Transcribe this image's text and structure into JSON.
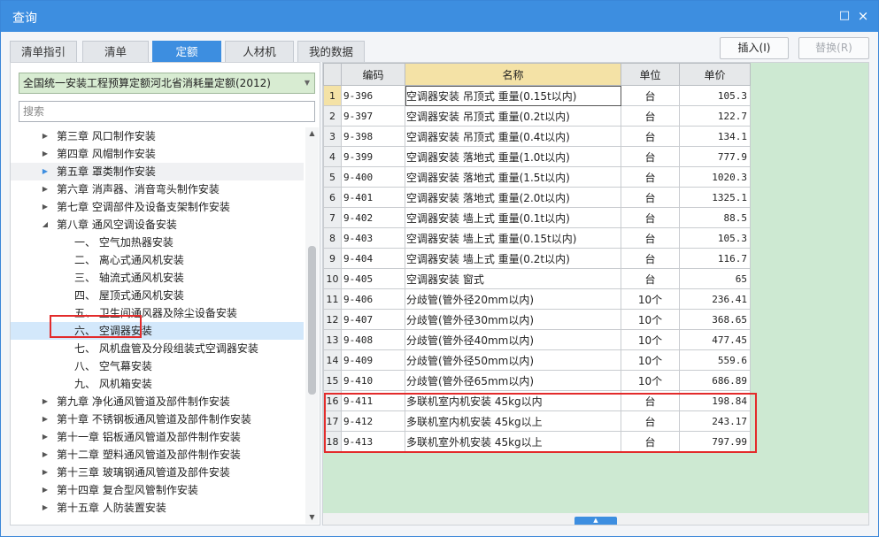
{
  "window": {
    "title": "查询",
    "maximize_icon": "maximize-icon",
    "close_icon": "close-icon",
    "close_glyph": "×",
    "maximize_glyph": "□"
  },
  "tabs": [
    {
      "label": "清单指引",
      "active": false
    },
    {
      "label": "清单",
      "active": false
    },
    {
      "label": "定额",
      "active": true
    },
    {
      "label": "人材机",
      "active": false
    },
    {
      "label": "我的数据",
      "active": false
    }
  ],
  "toolbar": {
    "insert_label": "插入(I)",
    "replace_label": "替换(R)"
  },
  "left": {
    "quota_library": "全国统一安装工程预算定额河北省消耗量定额(2012)",
    "search_placeholder": "搜索",
    "tree": [
      {
        "label": "第三章 风口制作安装",
        "level": 0,
        "expander": "collapsed"
      },
      {
        "label": "第四章 风帽制作安装",
        "level": 0,
        "expander": "collapsed"
      },
      {
        "label": "第五章 罩类制作安装",
        "level": 0,
        "expander": "collapsed-active",
        "highlight": true
      },
      {
        "label": "第六章 消声器、消音弯头制作安装",
        "level": 0,
        "expander": "collapsed"
      },
      {
        "label": "第七章 空调部件及设备支架制作安装",
        "level": 0,
        "expander": "collapsed"
      },
      {
        "label": "第八章 通风空调设备安装",
        "level": 0,
        "expander": "expanded"
      },
      {
        "label": "一、 空气加热器安装",
        "level": 1
      },
      {
        "label": "二、 离心式通风机安装",
        "level": 1
      },
      {
        "label": "三、 轴流式通风机安装",
        "level": 1
      },
      {
        "label": "四、 屋顶式通风机安装",
        "level": 1
      },
      {
        "label": "五、 卫生间通风器及除尘设备安装",
        "level": 1
      },
      {
        "label": "六、 空调器安装",
        "level": 1,
        "selected": true
      },
      {
        "label": "七、 风机盘管及分段组装式空调器安装",
        "level": 1
      },
      {
        "label": "八、 空气幕安装",
        "level": 1
      },
      {
        "label": "九、 风机箱安装",
        "level": 1
      },
      {
        "label": "第九章 净化通风管道及部件制作安装",
        "level": 0,
        "expander": "collapsed"
      },
      {
        "label": "第十章 不锈钢板通风管道及部件制作安装",
        "level": 0,
        "expander": "collapsed"
      },
      {
        "label": "第十一章 铝板通风管道及部件制作安装",
        "level": 0,
        "expander": "collapsed"
      },
      {
        "label": "第十二章 塑料通风管道及部件制作安装",
        "level": 0,
        "expander": "collapsed"
      },
      {
        "label": "第十三章 玻璃钢通风管道及部件安装",
        "level": 0,
        "expander": "collapsed"
      },
      {
        "label": "第十四章 复合型风管制作安装",
        "level": 0,
        "expander": "collapsed"
      },
      {
        "label": "第十五章 人防装置安装",
        "level": 0,
        "expander": "collapsed"
      }
    ]
  },
  "grid": {
    "headers": [
      "",
      "编码",
      "名称",
      "单位",
      "单价"
    ],
    "rows": [
      {
        "no": "1",
        "code": "9-396",
        "name": "空调器安装 吊顶式 重量(0.15t以内)",
        "unit": "台",
        "price": "105.3"
      },
      {
        "no": "2",
        "code": "9-397",
        "name": "空调器安装 吊顶式 重量(0.2t以内)",
        "unit": "台",
        "price": "122.7"
      },
      {
        "no": "3",
        "code": "9-398",
        "name": "空调器安装 吊顶式 重量(0.4t以内)",
        "unit": "台",
        "price": "134.1"
      },
      {
        "no": "4",
        "code": "9-399",
        "name": "空调器安装 落地式 重量(1.0t以内)",
        "unit": "台",
        "price": "777.9"
      },
      {
        "no": "5",
        "code": "9-400",
        "name": "空调器安装 落地式 重量(1.5t以内)",
        "unit": "台",
        "price": "1020.3"
      },
      {
        "no": "6",
        "code": "9-401",
        "name": "空调器安装 落地式 重量(2.0t以内)",
        "unit": "台",
        "price": "1325.1"
      },
      {
        "no": "7",
        "code": "9-402",
        "name": "空调器安装 墙上式 重量(0.1t以内)",
        "unit": "台",
        "price": "88.5"
      },
      {
        "no": "8",
        "code": "9-403",
        "name": "空调器安装 墙上式 重量(0.15t以内)",
        "unit": "台",
        "price": "105.3"
      },
      {
        "no": "9",
        "code": "9-404",
        "name": "空调器安装 墙上式 重量(0.2t以内)",
        "unit": "台",
        "price": "116.7"
      },
      {
        "no": "10",
        "code": "9-405",
        "name": "空调器安装 窗式",
        "unit": "台",
        "price": "65"
      },
      {
        "no": "11",
        "code": "9-406",
        "name": "分歧管(管外径20mm以内)",
        "unit": "10个",
        "price": "236.41"
      },
      {
        "no": "12",
        "code": "9-407",
        "name": "分歧管(管外径30mm以内)",
        "unit": "10个",
        "price": "368.65"
      },
      {
        "no": "13",
        "code": "9-408",
        "name": "分歧管(管外径40mm以内)",
        "unit": "10个",
        "price": "477.45"
      },
      {
        "no": "14",
        "code": "9-409",
        "name": "分歧管(管外径50mm以内)",
        "unit": "10个",
        "price": "559.6"
      },
      {
        "no": "15",
        "code": "9-410",
        "name": "分歧管(管外径65mm以内)",
        "unit": "10个",
        "price": "686.89"
      },
      {
        "no": "16",
        "code": "9-411",
        "name": "多联机室内机安装 45kg以内",
        "unit": "台",
        "price": "198.84"
      },
      {
        "no": "17",
        "code": "9-412",
        "name": "多联机室内机安装 45kg以上",
        "unit": "台",
        "price": "243.17"
      },
      {
        "no": "18",
        "code": "9-413",
        "name": "多联机室外机安装 45kg以上",
        "unit": "台",
        "price": "797.99"
      }
    ]
  },
  "colors": {
    "titlebar": "#3d8ee0",
    "active_tab": "#3d8ee0",
    "grid_background": "#cde9d2",
    "header_highlight": "#f4e2a6",
    "annotation_red": "#e32b2b",
    "tree_selected": "#d3e8fb"
  }
}
